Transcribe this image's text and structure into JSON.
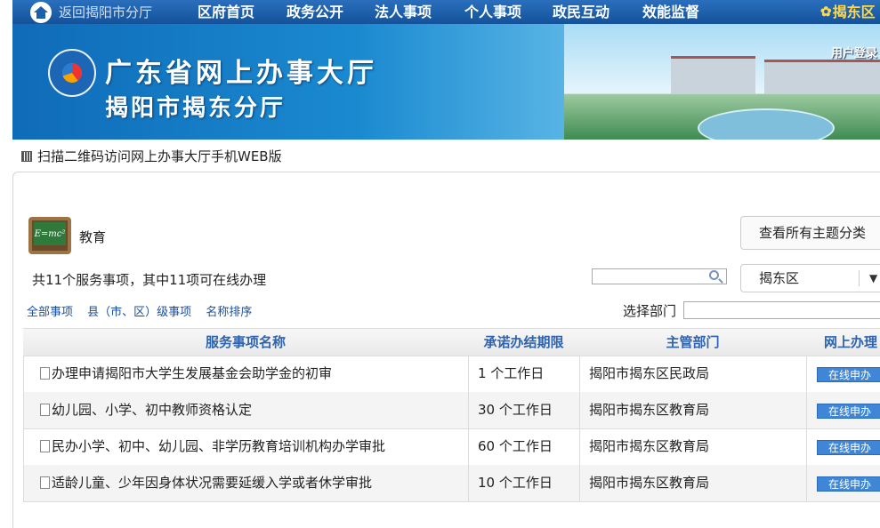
{
  "topnav": {
    "back": "返回揭阳市分厅",
    "items": [
      "区府首页",
      "政务公开",
      "法人事项",
      "个人事项",
      "政民互动",
      "效能监督"
    ],
    "region": "揭东区"
  },
  "banner": {
    "title_line1": "广东省网上办事大厅",
    "title_line2": "揭阳市揭东分厅",
    "login": "用户登录"
  },
  "qr_text": "扫描二维码访问网上办事大厅手机WEB版",
  "category": {
    "icon_text": "E=mc²",
    "name": "教育",
    "all_button": "查看所有主题分类"
  },
  "summary": "共11个服务事项，其中11项可在线办理",
  "search": {
    "placeholder": ""
  },
  "region_select": {
    "value": "揭东区"
  },
  "filters": [
    "全部事项",
    "县（市、区）级事项",
    "名称排序"
  ],
  "dept_label": "选择部门",
  "table": {
    "headers": [
      "服务事项名称",
      "承诺办结期限",
      "主管部门",
      "网上办理"
    ],
    "rows": [
      {
        "name": "办理申请揭阳市大学生发展基金会助学金的初审",
        "limit": "1 个工作日",
        "dept": "揭阳市揭东区民政局",
        "action": "在线申办"
      },
      {
        "name": "幼儿园、小学、初中教师资格认定",
        "limit": "30 个工作日",
        "dept": "揭阳市揭东区教育局",
        "action": "在线申办"
      },
      {
        "name": "民办小学、初中、幼儿园、非学历教育培训机构办学审批",
        "limit": "60 个工作日",
        "dept": "揭阳市揭东区教育局",
        "action": "在线申办"
      },
      {
        "name": "适龄儿童、少年因身体状况需要延缓入学或者休学审批",
        "limit": "10 个工作日",
        "dept": "揭阳市揭东区教育局",
        "action": "在线申办"
      }
    ]
  }
}
